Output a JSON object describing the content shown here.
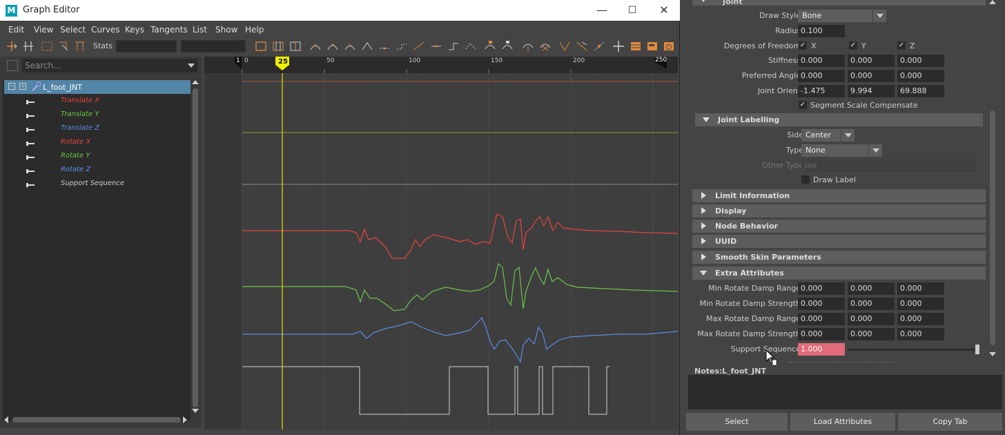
{
  "window": {
    "title": "Graph Editor",
    "logo_letter": "M",
    "minimize": "—",
    "maximize": "☐",
    "close": "✕"
  },
  "menu": [
    "Edit",
    "View",
    "Select",
    "Curves",
    "Keys",
    "Tangents",
    "List",
    "Show",
    "Help"
  ],
  "toolbar": {
    "stats_label": "Stats"
  },
  "outliner": {
    "search_placeholder": "Search...",
    "root": "L_foot_JNT",
    "channels": [
      {
        "label": "Translate X",
        "color": "#e8453c"
      },
      {
        "label": "Translate Y",
        "color": "#6ac64a"
      },
      {
        "label": "Translate Z",
        "color": "#5a8ee8"
      },
      {
        "label": "Rotate X",
        "color": "#e8453c"
      },
      {
        "label": "Rotate Y",
        "color": "#6ac64a"
      },
      {
        "label": "Rotate Z",
        "color": "#5a8ee8"
      },
      {
        "label": "Support Sequence",
        "color": "#cccccc"
      }
    ]
  },
  "timeline": {
    "start_frame": "1",
    "tick0": "0",
    "tick50": "50",
    "tick100": "100",
    "tick150": "150",
    "tick200": "200",
    "end_frame": "250",
    "current_frame": "25"
  },
  "attr": {
    "joint_header": "Joint",
    "draw_style_label": "Draw Style",
    "draw_style": "Bone",
    "radius_label": "Radius",
    "radius": "0.100",
    "dof_label": "Degrees of Freedom",
    "dof_x": "X",
    "dof_y": "Y",
    "dof_z": "Z",
    "stiffness_label": "Stiffness",
    "stiffness": [
      "0.000",
      "0.000",
      "0.000"
    ],
    "pref_angle_label": "Preferred Angle",
    "pref_angle": [
      "0.000",
      "0.000",
      "0.000"
    ],
    "joint_orient_label": "Joint Orient",
    "joint_orient": [
      "-1.475",
      "9.994",
      "69.888"
    ],
    "ssc_label": "Segment Scale Compensate",
    "joint_labelling": "Joint Labelling",
    "side_label": "Side",
    "side": "Center",
    "type_label": "Type",
    "type": "None",
    "other_type_label": "Other Type",
    "other_type": "jaw",
    "draw_label": "Draw Label",
    "sections": [
      "Limit Information",
      "Display",
      "Node Behavior",
      "UUID",
      "Smooth Skin Parameters"
    ],
    "extra_attributes": "Extra Attributes",
    "min_damp_range_label": "Min Rotate Damp Range",
    "min_damp_range": [
      "0.000",
      "0.000",
      "0.000"
    ],
    "min_damp_strength_label": "Min Rotate Damp Strength",
    "min_damp_strength": [
      "0.000",
      "0.000",
      "0.000"
    ],
    "max_damp_range_label": "Max Rotate Damp Range",
    "max_damp_range": [
      "0.000",
      "0.000",
      "0.000"
    ],
    "max_damp_strength_label": "Max Rotate Damp Strength",
    "max_damp_strength": [
      "0.000",
      "0.000",
      "0.000"
    ],
    "support_sequence_label": "Support Sequence",
    "support_sequence": "1.000",
    "notes_label": "Notes:",
    "notes_node": "L_foot_JNT",
    "buttons": [
      "Select",
      "Load Attributes",
      "Copy Tab"
    ]
  }
}
